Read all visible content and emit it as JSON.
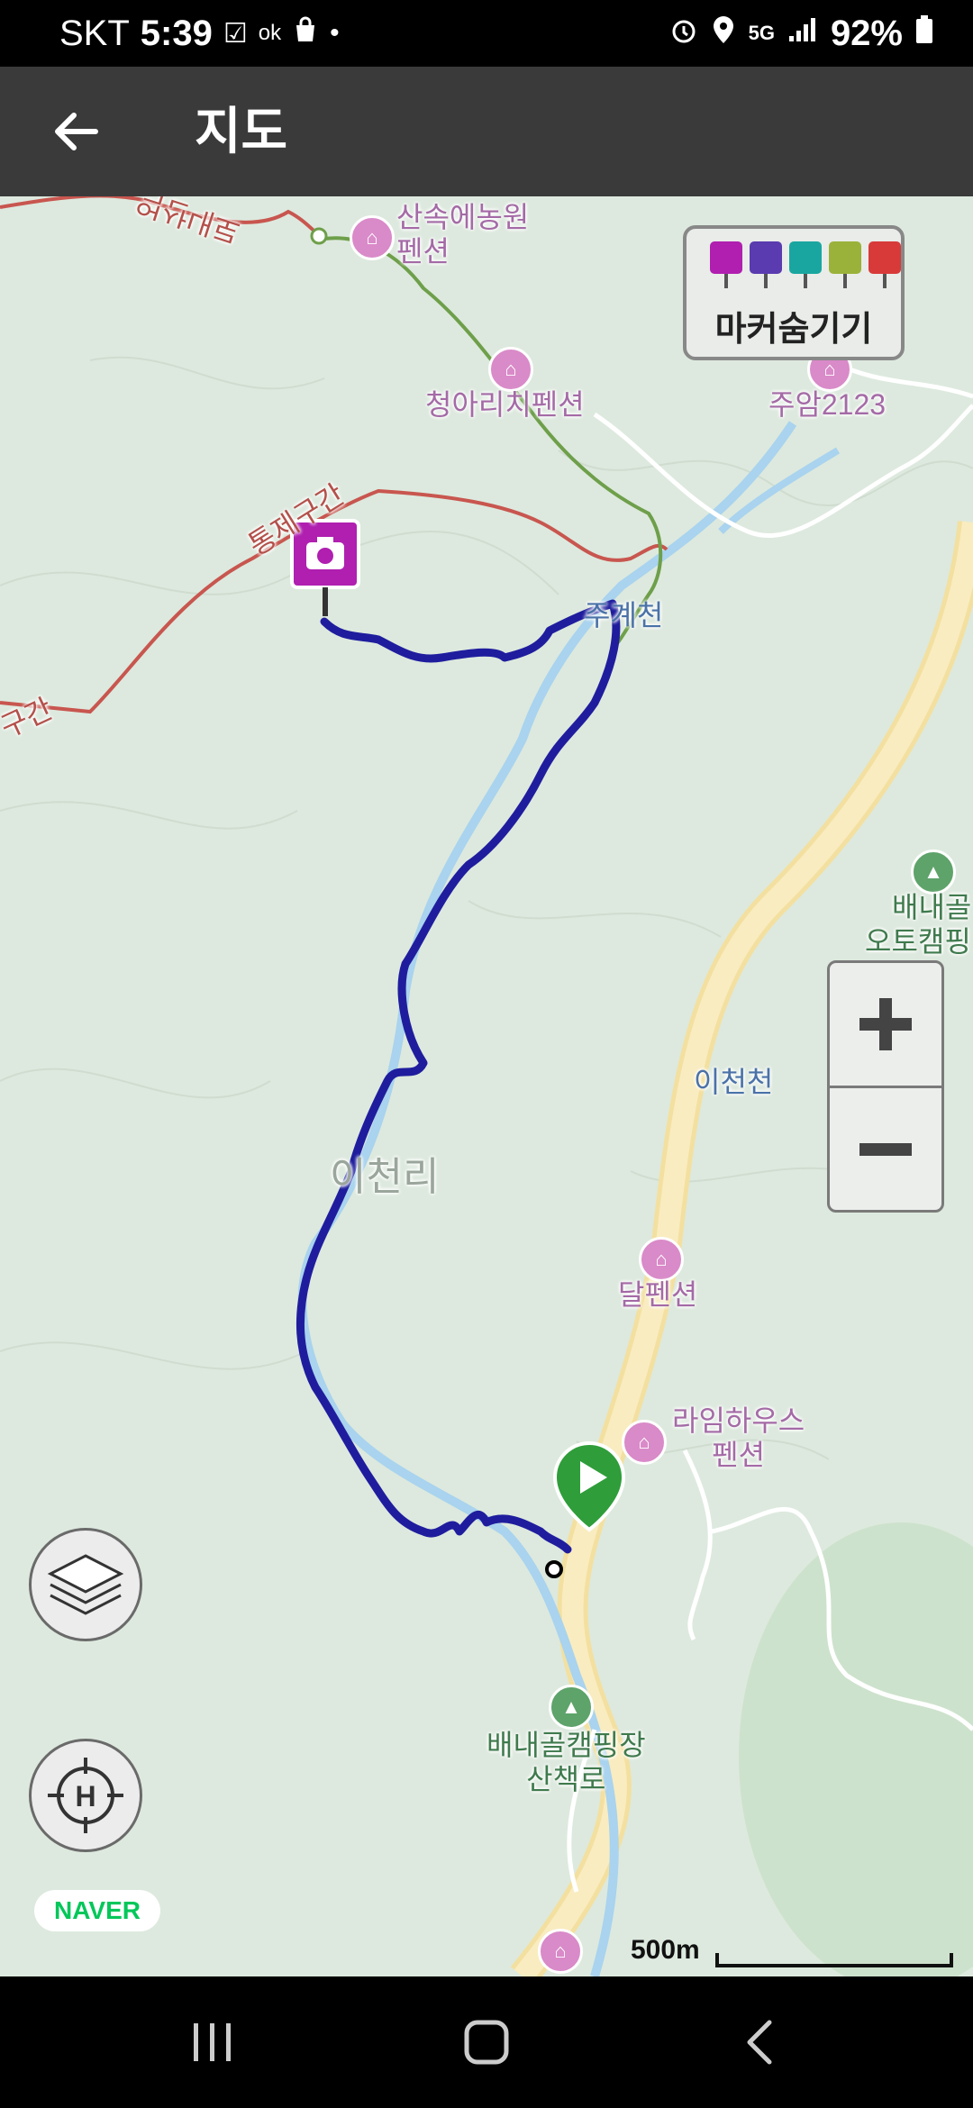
{
  "status_bar": {
    "carrier": "SKT",
    "time": "5:39",
    "network": "5G",
    "battery": "92%",
    "left_icons": [
      "check-icon",
      "ok-icon",
      "shopping-bag-icon",
      "dot-icon"
    ],
    "right_icons": [
      "alarm-icon",
      "location-icon",
      "5g-icon",
      "signal-icon",
      "battery-icon"
    ]
  },
  "app_bar": {
    "title": "지도",
    "back_icon": "arrow-left-icon"
  },
  "map": {
    "place_labels": {
      "sansok_1": "산속에농원",
      "sansok_2": "펜션",
      "cheongari": "청아리치펜션",
      "juam": "주암2123",
      "jugyecheon": "주계천",
      "icheonri": "이천리",
      "icheoncheon": "이천천",
      "dal": "달펜션",
      "laim_1": "라임하우스",
      "laim_2": "펜션",
      "camp_trail_1": "배내골캠핑장",
      "camp_trail_2": "산책로",
      "baenaegol_auto_1": "배내골",
      "baenaegol_auto_2": "오토캠핑",
      "control_zone": "통제구간",
      "control_zone_2": "구간",
      "trail_top": "억산내로"
    },
    "marker_panel": {
      "label": "마커숨기기",
      "icons": [
        "camera-marker-icon",
        "video-marker-icon",
        "memo-marker-icon",
        "note-marker-icon",
        "flag-marker-icon"
      ]
    },
    "zoom": {
      "in_icon": "plus-icon",
      "out_icon": "minus-icon"
    },
    "layers_icon": "layers-icon",
    "home_icon": "home-location-icon",
    "logo": "NAVER",
    "scale": "500m"
  },
  "nav_bar": {
    "icons": [
      "recent-apps-icon",
      "home-icon",
      "back-icon"
    ]
  },
  "colors": {
    "track": "#1f1d9e",
    "road": "#f7e6a4",
    "stream": "#a9d3ee",
    "trail_red": "#c8564f",
    "trail_green": "#6e9f4a",
    "camera_marker": "#b01fb0",
    "start_marker": "#2f9d3a"
  }
}
